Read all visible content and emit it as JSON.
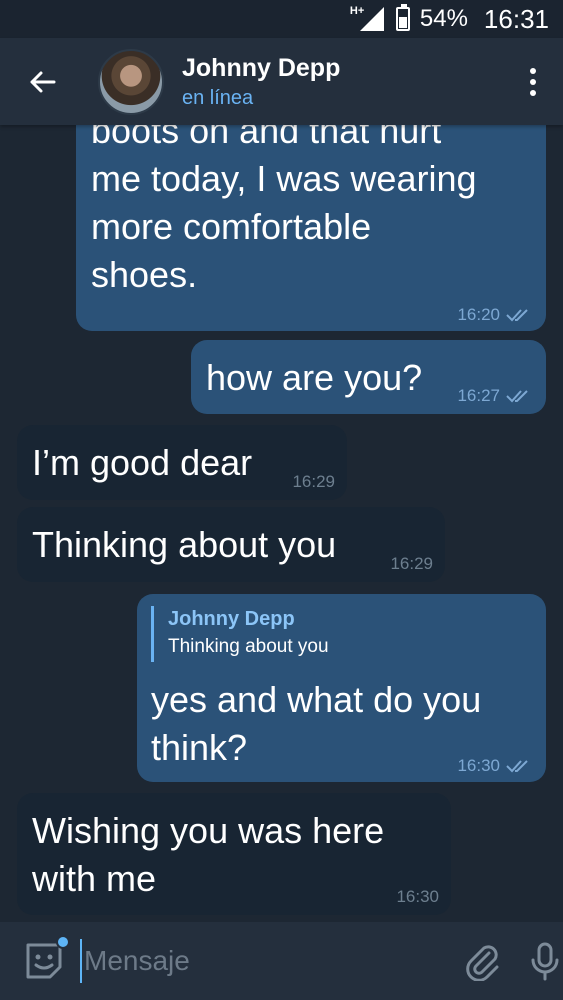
{
  "status_bar": {
    "network": "H+",
    "battery": "54%",
    "battery_level": 0.54,
    "time": "16:31"
  },
  "header": {
    "contact_name": "Johnny Depp",
    "contact_status": "en línea"
  },
  "messages": [
    {
      "direction": "out",
      "text": "boots on and that hurt\nme today, I was wearing\nmore comfortable\nshoes.",
      "time": "16:20",
      "read": true
    },
    {
      "direction": "out",
      "text": "how are you?",
      "time": "16:27",
      "read": true
    },
    {
      "direction": "in",
      "text": "I’m good dear",
      "time": "16:29"
    },
    {
      "direction": "in",
      "text": "Thinking about you",
      "time": "16:29"
    },
    {
      "direction": "out",
      "reply_to": {
        "name": "Johnny Depp",
        "text": "Thinking about you"
      },
      "text": "yes and what do you\nthink?",
      "time": "16:30",
      "read": true
    },
    {
      "direction": "in",
      "text": "Wishing you was here\nwith me",
      "time": "16:30"
    }
  ],
  "input_bar": {
    "placeholder": "Mensaje"
  },
  "colors": {
    "background": "#1d2733",
    "header": "#242f3d",
    "outgoing_bubble": "#2b5278",
    "incoming_bubble": "#182533",
    "accent": "#6ab3f3"
  }
}
